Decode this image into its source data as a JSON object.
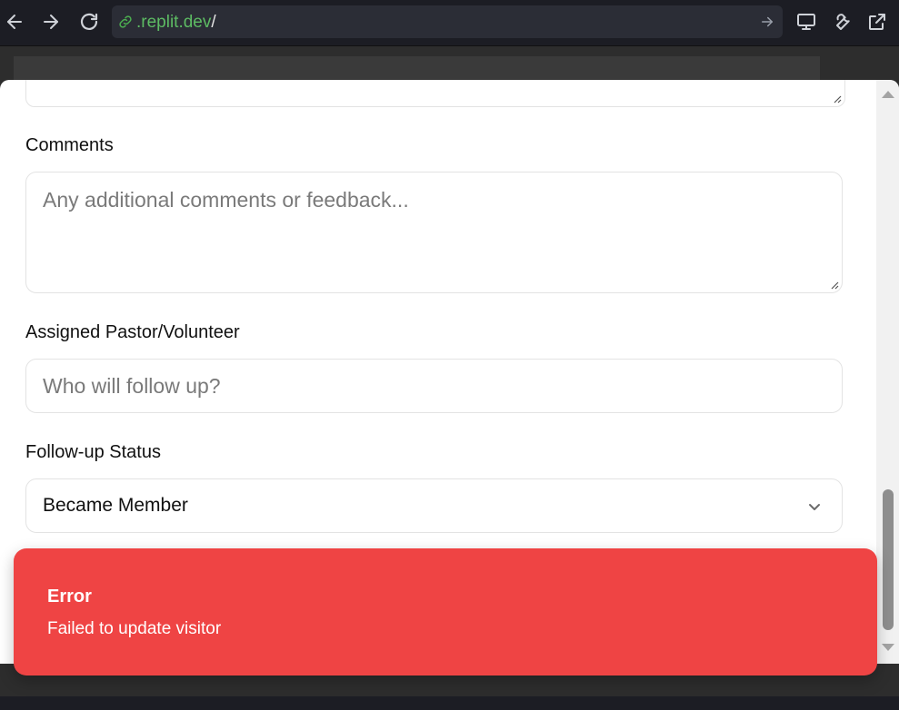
{
  "browser": {
    "url_domain": ".replit.dev",
    "url_slash": "/"
  },
  "form": {
    "comments_label": "Comments",
    "comments_placeholder": "Any additional comments or feedback...",
    "pastor_label": "Assigned Pastor/Volunteer",
    "pastor_placeholder": "Who will follow up?",
    "status_label": "Follow-up Status",
    "status_value": "Became Member"
  },
  "toast": {
    "title": "Error",
    "description": "Failed to update visitor",
    "color": "#ef4444"
  },
  "icons": {
    "back": "arrow-left-icon",
    "forward": "arrow-right-icon",
    "reload": "reload-icon",
    "link": "link-icon",
    "go": "arrow-right-icon",
    "devices": "monitor-icon",
    "tools": "wrench-icon",
    "open_external": "external-link-icon",
    "select": "chevron-down-icon"
  }
}
